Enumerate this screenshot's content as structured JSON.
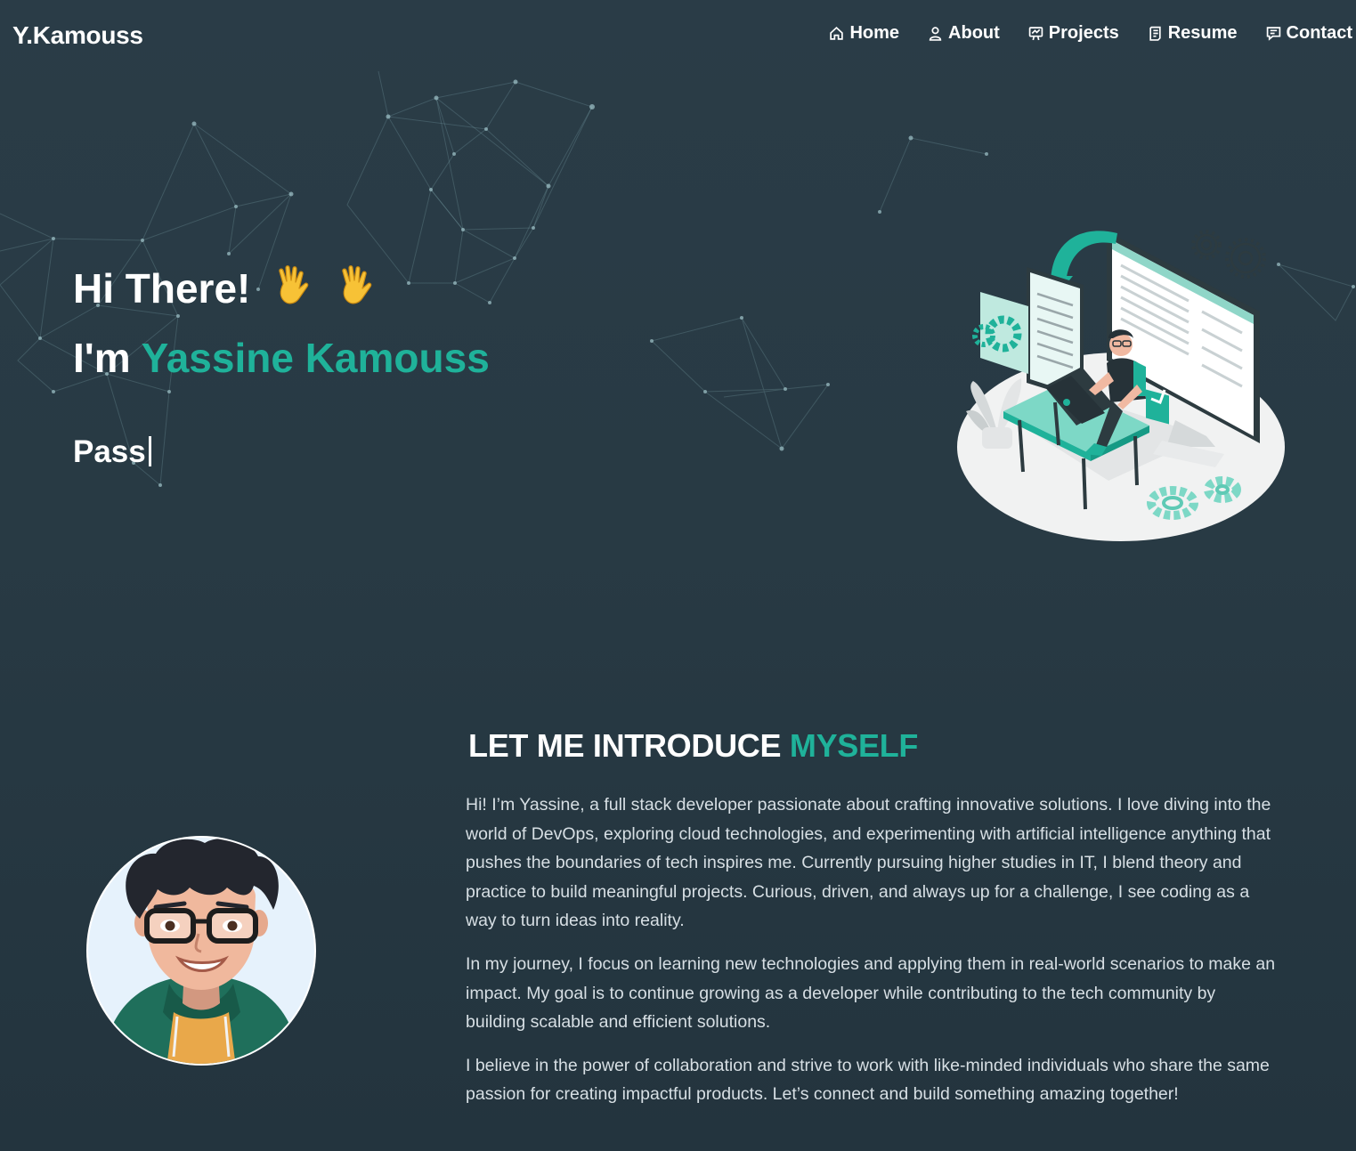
{
  "brand": {
    "logo_text": "Y.Kamouss"
  },
  "nav": {
    "items": [
      {
        "label": "Home",
        "icon": "home-icon"
      },
      {
        "label": "About",
        "icon": "user-icon"
      },
      {
        "label": "Projects",
        "icon": "presentation-icon"
      },
      {
        "label": "Resume",
        "icon": "document-icon"
      },
      {
        "label": "Contact",
        "icon": "chat-icon"
      }
    ]
  },
  "hero": {
    "greeting": "Hi There!",
    "wave_emoji": "✋",
    "intro_prefix": "I'm",
    "name": "Yassine Kamouss",
    "typed_text": "Pass",
    "illustration_icon": "developer-workspace-illustration"
  },
  "about": {
    "heading_main": "LET ME INTRODUCE",
    "heading_accent": "MYSELF",
    "paragraphs": [
      "Hi! I’m Yassine, a full stack developer passionate about crafting innovative solutions. I love diving into the world of DevOps, exploring cloud technologies, and experimenting with artificial intelligence anything that pushes the boundaries of tech inspires me. Currently pursuing higher studies in IT, I blend theory and practice to build meaningful projects. Curious, driven, and always up for a challenge, I see coding as a way to turn ideas into reality.",
      "In my journey, I focus on learning new technologies and applying them in real-world scenarios to make an impact. My goal is to continue growing as a developer while contributing to the tech community by building scalable and efficient solutions.",
      "I believe in the power of collaboration and strive to work with like-minded individuals who share the same passion for creating impactful products. Let’s connect and build something amazing together!"
    ],
    "avatar_icon": "avatar-illustration"
  },
  "colors": {
    "accent": "#1fb29a",
    "background": "#283a44",
    "text": "#ffffff",
    "body_text": "#d7dfe4",
    "emoji_yellow": "#f7c236"
  }
}
